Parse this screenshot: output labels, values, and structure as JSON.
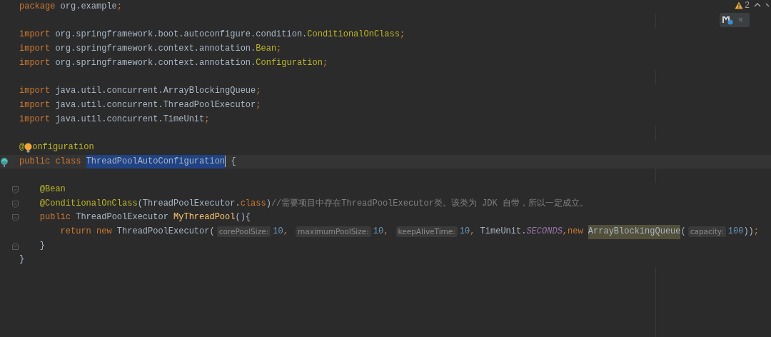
{
  "warnings": {
    "count": "2"
  },
  "lines": [
    {
      "kind": "code",
      "tokens": [
        {
          "t": "package ",
          "kind": "kw"
        },
        {
          "t": "org.example",
          "kind": "text"
        },
        {
          "t": ";",
          "kind": "kw"
        }
      ]
    },
    {
      "kind": "blank"
    },
    {
      "kind": "code",
      "tokens": [
        {
          "t": "import ",
          "kind": "kw"
        },
        {
          "t": "org.springframework.boot.autoconfigure.condition.",
          "kind": "text"
        },
        {
          "t": "ConditionalOnClass",
          "kind": "ann"
        },
        {
          "t": ";",
          "kind": "kw"
        }
      ]
    },
    {
      "kind": "code",
      "tokens": [
        {
          "t": "import ",
          "kind": "kw"
        },
        {
          "t": "org.springframework.context.annotation.",
          "kind": "text"
        },
        {
          "t": "Bean",
          "kind": "ann"
        },
        {
          "t": ";",
          "kind": "kw"
        }
      ]
    },
    {
      "kind": "code",
      "tokens": [
        {
          "t": "import ",
          "kind": "kw"
        },
        {
          "t": "org.springframework.context.annotation.",
          "kind": "text"
        },
        {
          "t": "Configuration",
          "kind": "ann"
        },
        {
          "t": ";",
          "kind": "kw"
        }
      ]
    },
    {
      "kind": "blank"
    },
    {
      "kind": "code",
      "tokens": [
        {
          "t": "import ",
          "kind": "kw"
        },
        {
          "t": "java.util.concurrent.ArrayBlockingQueue",
          "kind": "text"
        },
        {
          "t": ";",
          "kind": "kw"
        }
      ]
    },
    {
      "kind": "code",
      "tokens": [
        {
          "t": "import ",
          "kind": "kw"
        },
        {
          "t": "java.util.concurrent.ThreadPoolExecutor",
          "kind": "text"
        },
        {
          "t": ";",
          "kind": "kw"
        }
      ]
    },
    {
      "kind": "code",
      "tokens": [
        {
          "t": "import ",
          "kind": "kw"
        },
        {
          "t": "java.util.concurrent.TimeUnit",
          "kind": "text"
        },
        {
          "t": ";",
          "kind": "kw"
        }
      ]
    },
    {
      "kind": "blank"
    },
    {
      "kind": "code",
      "tokens": [
        {
          "t": "@",
          "kind": "ann"
        },
        {
          "kind": "bulb"
        },
        {
          "t": "onfiguration",
          "kind": "ann"
        }
      ]
    },
    {
      "kind": "code",
      "current": true,
      "marker": {
        "kind": "bean"
      },
      "tokens": [
        {
          "t": "public class ",
          "kind": "kw"
        },
        {
          "t": "ThreadPoolAutoConfiguration",
          "kind": "selected"
        },
        {
          "kind": "caret"
        },
        {
          "t": " {",
          "kind": "text"
        }
      ]
    },
    {
      "kind": "blank"
    },
    {
      "kind": "code",
      "marker": {
        "kind": "fold-start"
      },
      "tokens": [
        {
          "t": "    @Bean",
          "kind": "ann"
        }
      ]
    },
    {
      "kind": "code",
      "marker": {
        "kind": "fold-mid"
      },
      "tokens": [
        {
          "t": "    @ConditionalOnClass",
          "kind": "ann"
        },
        {
          "t": "(ThreadPoolExecutor.",
          "kind": "text"
        },
        {
          "t": "class",
          "kind": "kw"
        },
        {
          "t": ")",
          "kind": "text"
        },
        {
          "t": "//需要项目中存在ThreadPoolExecutor类。该类为 JDK 自带，所以一定成立。",
          "kind": "comment"
        }
      ]
    },
    {
      "kind": "code",
      "marker": {
        "kind": "fold-start"
      },
      "tokens": [
        {
          "t": "    public ",
          "kind": "kw"
        },
        {
          "t": "ThreadPoolExecutor ",
          "kind": "text"
        },
        {
          "t": "MyThreadPool",
          "kind": "method"
        },
        {
          "t": "(){",
          "kind": "text"
        }
      ]
    },
    {
      "kind": "code",
      "tokens": [
        {
          "t": "        return new ",
          "kind": "kw"
        },
        {
          "t": "ThreadPoolExecutor(",
          "kind": "text"
        },
        {
          "t": "corePoolSize:",
          "kind": "hint"
        },
        {
          "t": "10",
          "kind": "num"
        },
        {
          "t": ", ",
          "kind": "kw"
        },
        {
          "t": "maximumPoolSize:",
          "kind": "hint"
        },
        {
          "t": "10",
          "kind": "num"
        },
        {
          "t": ", ",
          "kind": "kw"
        },
        {
          "t": "keepAliveTime:",
          "kind": "hint"
        },
        {
          "t": "10",
          "kind": "num"
        },
        {
          "t": ", ",
          "kind": "kw"
        },
        {
          "t": "TimeUnit.",
          "kind": "text"
        },
        {
          "t": "SECONDS",
          "kind": "static"
        },
        {
          "t": ",new ",
          "kind": "kw"
        },
        {
          "t": "ArrayBlockingQueue",
          "kind": "match"
        },
        {
          "t": "(",
          "kind": "text"
        },
        {
          "t": "capacity:",
          "kind": "hint"
        },
        {
          "t": "100",
          "kind": "num"
        },
        {
          "t": "))",
          "kind": "text"
        },
        {
          "t": ";",
          "kind": "kw"
        }
      ]
    },
    {
      "kind": "code",
      "marker": {
        "kind": "fold-end"
      },
      "tokens": [
        {
          "t": "    }",
          "kind": "text"
        }
      ]
    },
    {
      "kind": "code",
      "tokens": [
        {
          "t": "}",
          "kind": "text"
        }
      ]
    }
  ],
  "popup": {
    "close": "×"
  }
}
